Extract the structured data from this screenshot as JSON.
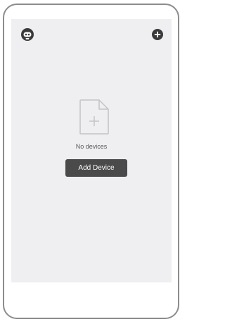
{
  "header": {
    "left_icon": "robot-icon",
    "right_icon": "plus-circle-icon"
  },
  "empty_state": {
    "icon": "add-file-icon",
    "message": "No devices",
    "action_label": "Add Device"
  },
  "colors": {
    "device_frame": "#8c8c8c",
    "screen_background": "#efeff1",
    "button_background": "#4a4a4a",
    "icon_fill": "#3a3a3a"
  }
}
